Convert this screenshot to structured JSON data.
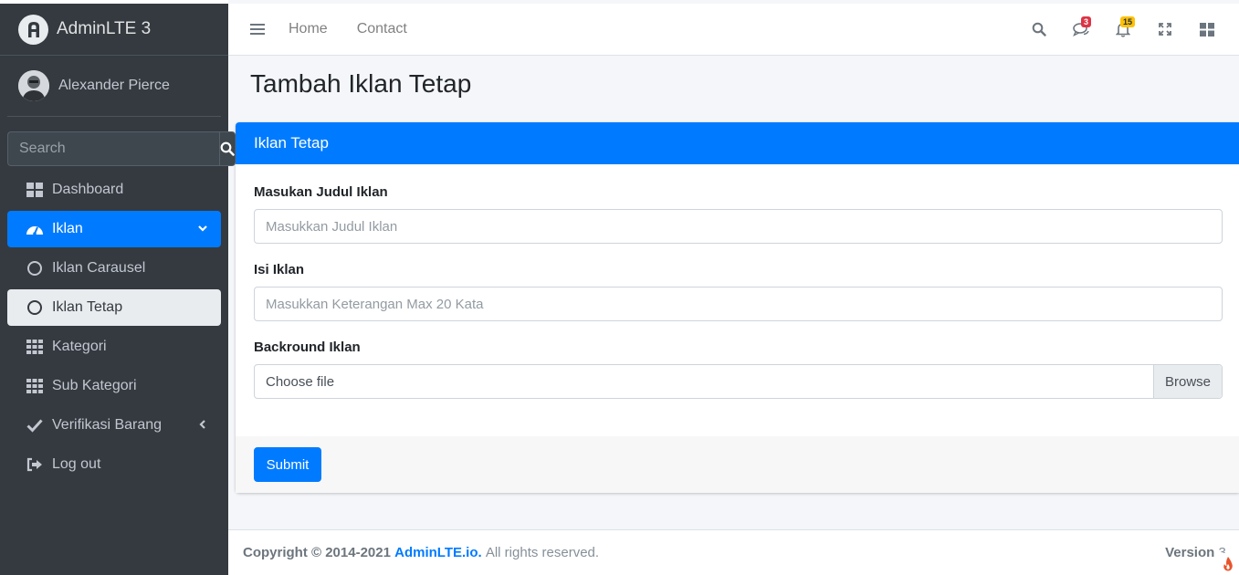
{
  "brand": {
    "name": "AdminLTE 3"
  },
  "user": {
    "name": "Alexander Pierce"
  },
  "sidebar_search": {
    "placeholder": "Search"
  },
  "nav": [
    {
      "label": "Dashboard",
      "icon": "dashboard-tiles-icon"
    },
    {
      "label": "Iklan",
      "icon": "tachometer-icon",
      "active": true
    },
    {
      "label": "Iklan Carausel",
      "icon": "circle-outline-icon"
    },
    {
      "label": "Iklan Tetap",
      "icon": "circle-outline-icon",
      "selected": true
    },
    {
      "label": "Kategori",
      "icon": "grid-icon"
    },
    {
      "label": "Sub Kategori",
      "icon": "grid-icon"
    },
    {
      "label": "Verifikasi Barang",
      "icon": "check-icon"
    },
    {
      "label": "Log out",
      "icon": "sign-out-icon"
    }
  ],
  "topbar": {
    "links": [
      "Home",
      "Contact"
    ],
    "messages_count": "3",
    "notifications_count": "15"
  },
  "page": {
    "title": "Tambah Iklan Tetap"
  },
  "card": {
    "header": "Iklan Tetap"
  },
  "form": {
    "judul_label": "Masukan Judul Iklan",
    "judul_placeholder": "Masukkan Judul Iklan",
    "isi_label": "Isi Iklan",
    "isi_placeholder": "Masukkan Keterangan Max 20 Kata",
    "bg_label": "Backround Iklan",
    "file_label": "Choose file",
    "browse_label": "Browse",
    "submit_label": "Submit"
  },
  "footer": {
    "copyright": "Copyright © 2014-2021",
    "link_text": "AdminLTE.io.",
    "rights": "All rights reserved.",
    "version_label": "Version",
    "version_value": "3."
  },
  "colors": {
    "primary": "#007bff",
    "sidebar": "#343a40",
    "danger": "#dc3545",
    "warning": "#ffc107"
  }
}
